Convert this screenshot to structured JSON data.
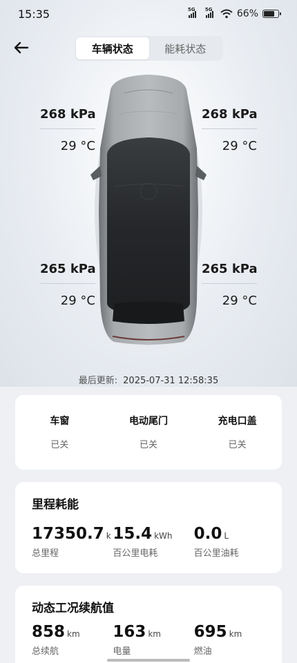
{
  "status_bar": {
    "time": "15:35",
    "signal1": "5G",
    "signal2": "5G",
    "battery": "66%",
    "battery_level": 0.66
  },
  "nav": {
    "back_icon": "back-arrow-icon",
    "tabs": [
      {
        "label": "车辆状态",
        "active": true
      },
      {
        "label": "能耗状态",
        "active": false
      }
    ]
  },
  "tires": {
    "front_left": {
      "pressure": "268 kPa",
      "temp": "29 °C"
    },
    "front_right": {
      "pressure": "268 kPa",
      "temp": "29 °C"
    },
    "rear_left": {
      "pressure": "265 kPa",
      "temp": "29 °C"
    },
    "rear_right": {
      "pressure": "265 kPa",
      "temp": "29 °C"
    }
  },
  "updated": {
    "label": "最后更新:",
    "value": "2025-07-31 12:58:35"
  },
  "vehicle_status": [
    {
      "name": "车窗",
      "value": "已关"
    },
    {
      "name": "电动尾门",
      "value": "已关"
    },
    {
      "name": "充电口盖",
      "value": "已关"
    }
  ],
  "mileage": {
    "title": "里程耗能",
    "items": [
      {
        "value": "17350.7",
        "unit": "k",
        "label": "总里程"
      },
      {
        "value": "15.4",
        "unit": "kWh",
        "label": "百公里电耗"
      },
      {
        "value": "0.0",
        "unit": "L",
        "label": "百公里油耗"
      }
    ]
  },
  "range": {
    "title": "动态工况续航值",
    "items": [
      {
        "value": "858",
        "unit": "km",
        "label": "总续航"
      },
      {
        "value": "163",
        "unit": "km",
        "label": "电量"
      },
      {
        "value": "695",
        "unit": "km",
        "label": "燃油"
      }
    ]
  },
  "colors": {
    "background": "#eef0f3",
    "card": "#ffffff",
    "tab_active": "#ffffff",
    "car_body": "#8e9294",
    "car_roof": "#2b2d30"
  }
}
